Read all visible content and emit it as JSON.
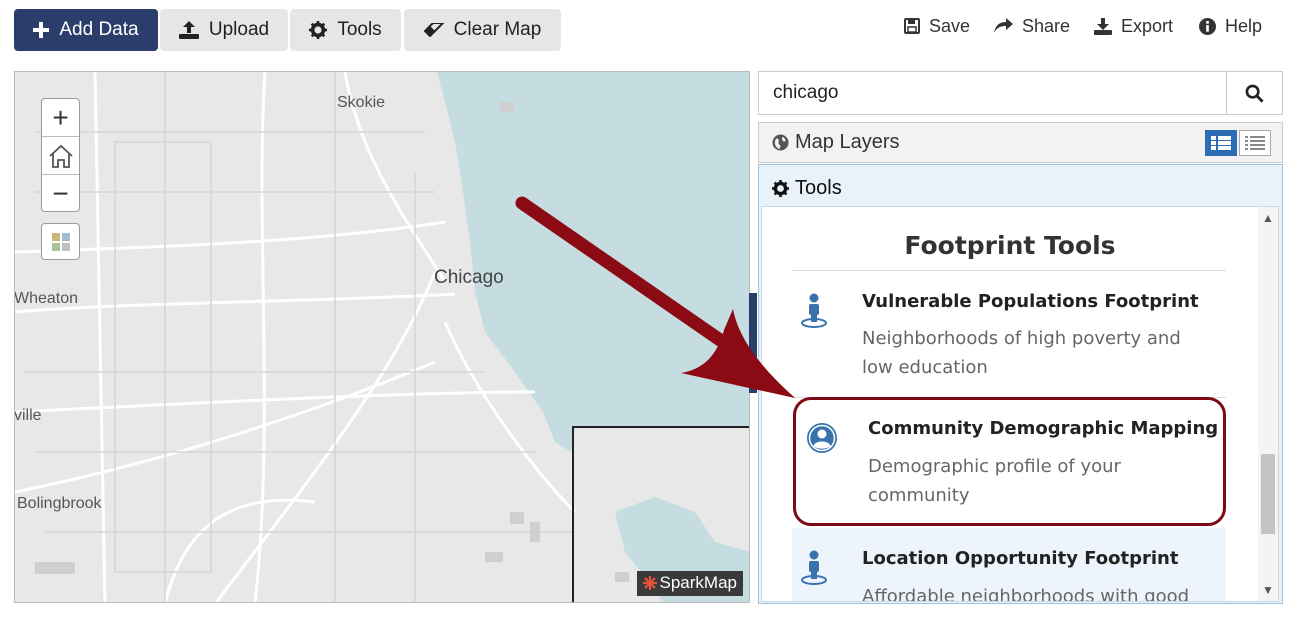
{
  "toolbar": {
    "add_data": "Add Data",
    "upload": "Upload",
    "tools": "Tools",
    "clear_map": "Clear Map"
  },
  "header_links": {
    "save": "Save",
    "share": "Share",
    "export": "Export",
    "help": "Help"
  },
  "map": {
    "labels": [
      "Skokie",
      "Chicago",
      "Wheaton",
      "ville",
      "Bolingbrook"
    ],
    "attribution": "SparkMap",
    "zoom_in": "+",
    "zoom_out": "−"
  },
  "search": {
    "value": "chicago"
  },
  "layers_panel": {
    "title": "Map Layers"
  },
  "tools_panel": {
    "title": "Tools",
    "section_title": "Footprint Tools",
    "items": [
      {
        "title": "Vulnerable Populations Footprint",
        "description": "Neighborhoods of high poverty and low education",
        "icon": "person-pin-icon"
      },
      {
        "title": "Community Demographic Mapping",
        "description": "Demographic profile of your community",
        "icon": "person-circle-icon"
      },
      {
        "title": "Location Opportunity Footprint",
        "description": "Affordable neighborhoods with good",
        "icon": "person-pin-icon"
      }
    ]
  },
  "colors": {
    "primary": "#2b3e6b",
    "water": "#c5dde0",
    "highlight": "#7d0a16",
    "icon_blue": "#3a72ad"
  }
}
